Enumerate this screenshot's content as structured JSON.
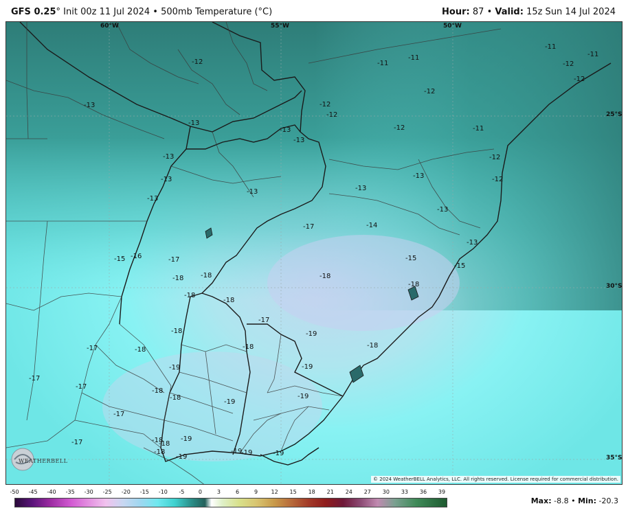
{
  "header": {
    "model": "GFS 0.25",
    "degree_symbol": "°",
    "init": "Init 00z 11 Jul 2024",
    "separator": "•",
    "product": "500mb Temperature (°C)",
    "hour_label": "Hour:",
    "hour_value": "87",
    "valid_label": "Valid:",
    "valid_value": "15z Sun 14 Jul 2024"
  },
  "coords": {
    "lon60": "60°W",
    "lon55": "55°W",
    "lon50": "50°W",
    "lat25": "25°S",
    "lat30": "30°S",
    "lat35": "35°S"
  },
  "values": [
    {
      "text": "-12"
    },
    {
      "text": "-11"
    },
    {
      "text": "-11"
    },
    {
      "text": "-11"
    },
    {
      "text": "-11"
    },
    {
      "text": "-12"
    },
    {
      "text": "-12"
    },
    {
      "text": "-13"
    },
    {
      "text": "-12"
    },
    {
      "text": "-12"
    },
    {
      "text": "-12"
    },
    {
      "text": "-12"
    },
    {
      "text": "-11"
    },
    {
      "text": "-13"
    },
    {
      "text": "-13"
    },
    {
      "text": "-13"
    },
    {
      "text": "-12"
    },
    {
      "text": "-13"
    },
    {
      "text": "-13"
    },
    {
      "text": "-12"
    },
    {
      "text": "-13"
    },
    {
      "text": "-13"
    },
    {
      "text": "-13"
    },
    {
      "text": "-13"
    },
    {
      "text": "-13"
    },
    {
      "text": "-17"
    },
    {
      "text": "-14"
    },
    {
      "text": "-13"
    },
    {
      "text": "-15"
    },
    {
      "text": "-16"
    },
    {
      "text": "-17"
    },
    {
      "text": "-15"
    },
    {
      "text": "-15"
    },
    {
      "text": "-18"
    },
    {
      "text": "-18"
    },
    {
      "text": "-18"
    },
    {
      "text": "-18"
    },
    {
      "text": "-18"
    },
    {
      "text": "-18"
    },
    {
      "text": "-17"
    },
    {
      "text": "-18"
    },
    {
      "text": "-19"
    },
    {
      "text": "-17"
    },
    {
      "text": "-18"
    },
    {
      "text": "-18"
    },
    {
      "text": "-18"
    },
    {
      "text": "-19"
    },
    {
      "text": "-19"
    },
    {
      "text": "-17"
    },
    {
      "text": "-17"
    },
    {
      "text": "-18"
    },
    {
      "text": "-18"
    },
    {
      "text": "-19"
    },
    {
      "text": "-19"
    },
    {
      "text": "-17"
    },
    {
      "text": "-17"
    },
    {
      "text": "-18"
    },
    {
      "text": "-18"
    },
    {
      "text": "-19"
    },
    {
      "text": "-18"
    },
    {
      "text": "-19"
    },
    {
      "text": "-19"
    },
    {
      "text": "-19"
    },
    {
      "text": "-19"
    }
  ],
  "copyright": "© 2024 WeatherBELL Analytics, LLC. All rights reserved. License required for commercial distribution.",
  "logo": "WEATHERBELL",
  "colorbar": {
    "ticks": [
      "-50",
      "-45",
      "-40",
      "-35",
      "-30",
      "-25",
      "-20",
      "-15",
      "-10",
      "-5",
      "0",
      "3",
      "6",
      "9",
      "12",
      "15",
      "18",
      "21",
      "24",
      "27",
      "30",
      "33",
      "36",
      "39"
    ],
    "max_label": "Max:",
    "max_value": "-8.8",
    "sep": "•",
    "min_label": "Min:",
    "min_value": "-20.3"
  }
}
